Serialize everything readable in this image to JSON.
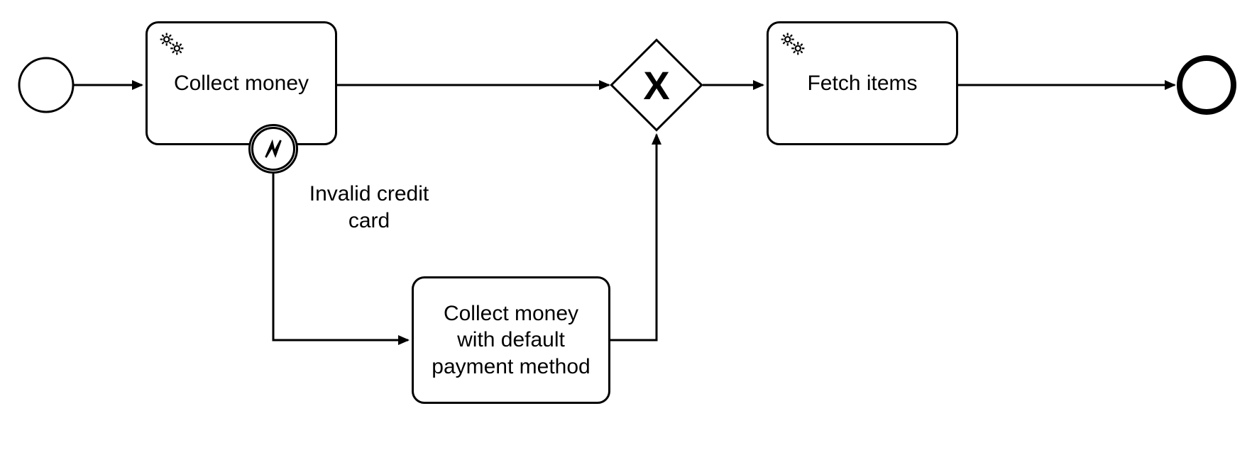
{
  "tasks": {
    "collect_money": "Collect money",
    "collect_default": "Collect money with default payment method",
    "fetch_items": "Fetch items"
  },
  "events": {
    "error_label": "Invalid credit card"
  }
}
